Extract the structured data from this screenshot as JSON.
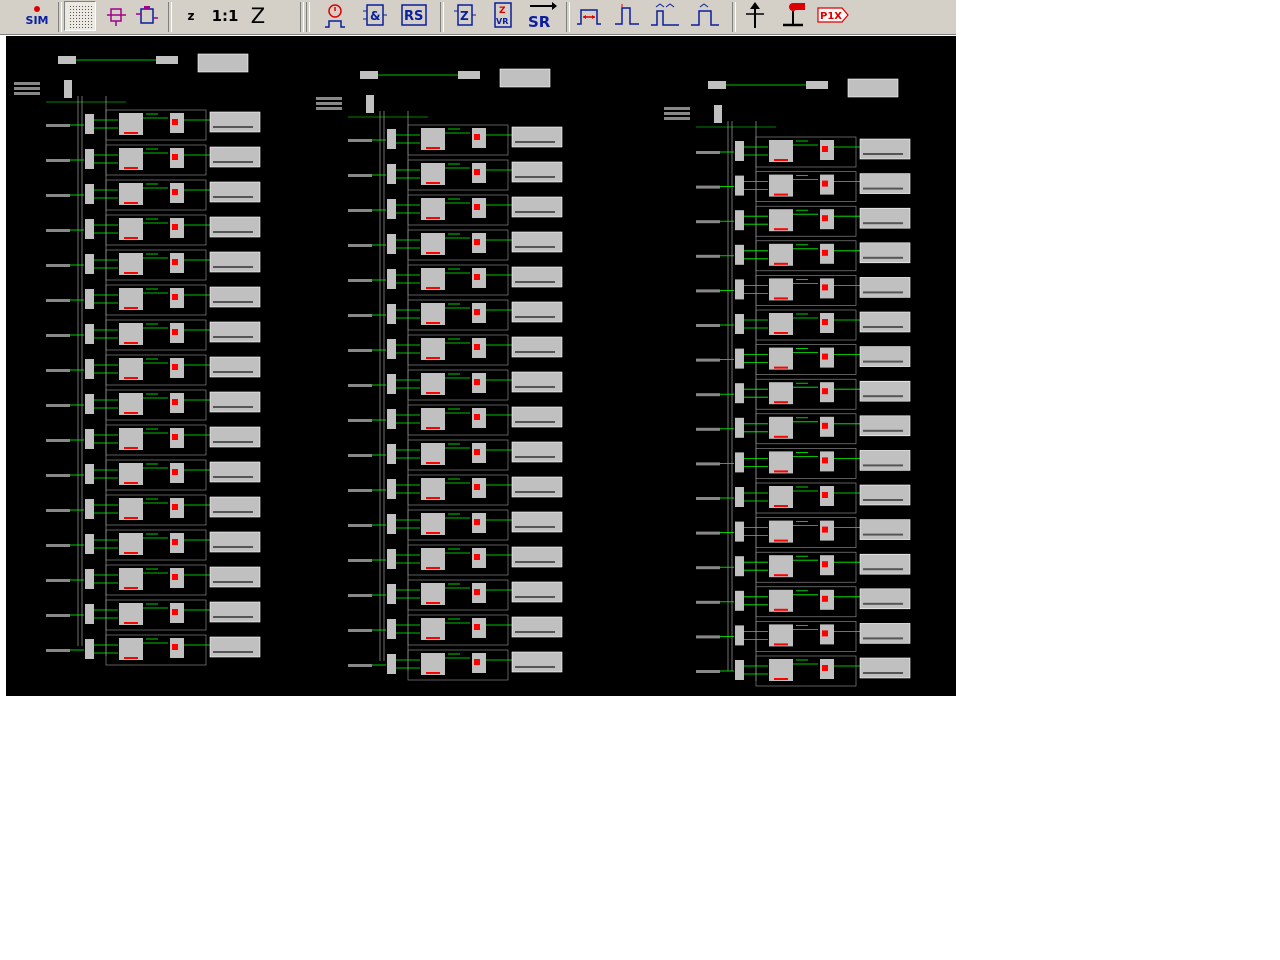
{
  "toolbar": {
    "sim_label": "SIM",
    "zoom_out_label": "z",
    "zoom_reset_label": "1:1",
    "zoom_in_label": "Z",
    "and_label": "&",
    "rs_label": "RS",
    "z_label": "Z",
    "zvr_top_label": "Z",
    "zvr_bottom_label": "VR",
    "sr_label": "SR",
    "p1x_label": "P1X"
  },
  "colors": {
    "toolbar_bg": "#d4d0c8",
    "canvas_bg": "#000000",
    "wire": "#00ff00",
    "block": "#c0c0c0",
    "marker": "#ff0000",
    "icon": "#0a1e9e"
  },
  "diagram": {
    "sections": 3,
    "rows_per_section": 16
  }
}
